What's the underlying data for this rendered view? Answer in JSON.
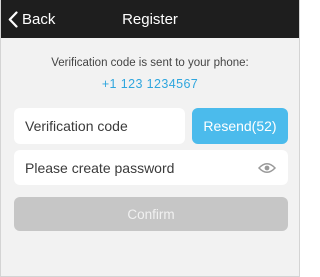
{
  "header": {
    "back_label": "Back",
    "title": "Register",
    "back_icon": "chevron-left-icon",
    "background": "#1e1e1e"
  },
  "notice": {
    "message": "Verification code is sent to your phone:",
    "phone_number": "+1 123 1234567",
    "phone_color": "#2fa6de"
  },
  "form": {
    "code_placeholder": "Verification code",
    "resend_label": "Resend(52)",
    "resend_color": "#4bbbec",
    "password_placeholder": "Please create password",
    "password_icon": "eye-icon",
    "confirm_label": "Confirm",
    "confirm_color": "#c6c6c6"
  }
}
